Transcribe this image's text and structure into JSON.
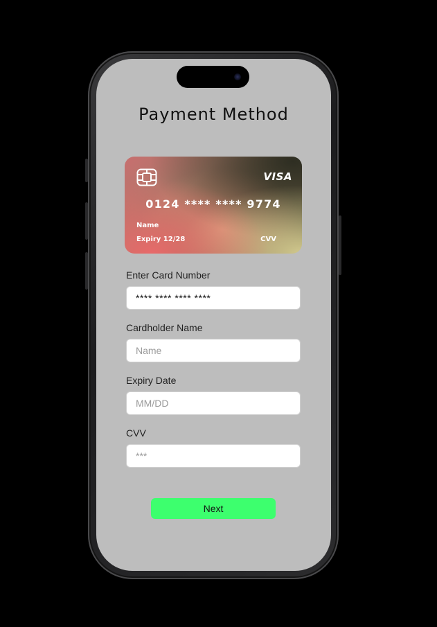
{
  "page": {
    "title": "Payment Method"
  },
  "card": {
    "brand": "VISA",
    "number": "0124 **** **** 9774",
    "name_label": "Name",
    "expiry_label": "Expiry 12/28",
    "cvv_label": "CVV",
    "icons": {
      "chip": "card-chip-icon"
    }
  },
  "form": {
    "card_number": {
      "label": "Enter Card Number",
      "value": "**** **** **** ****",
      "placeholder": ""
    },
    "cardholder_name": {
      "label": "Cardholder Name",
      "value": "",
      "placeholder": "Name"
    },
    "expiry_date": {
      "label": "Expiry Date",
      "value": "",
      "placeholder": "MM/DD"
    },
    "cvv": {
      "label": "CVV",
      "value": "",
      "placeholder": "***"
    }
  },
  "actions": {
    "next_label": "Next"
  },
  "colors": {
    "screen_background": "#bdbdbd",
    "next_button": "#3dff6e",
    "card_gradient_start": "#e86a6a",
    "card_gradient_end": "#5c5a3c"
  }
}
